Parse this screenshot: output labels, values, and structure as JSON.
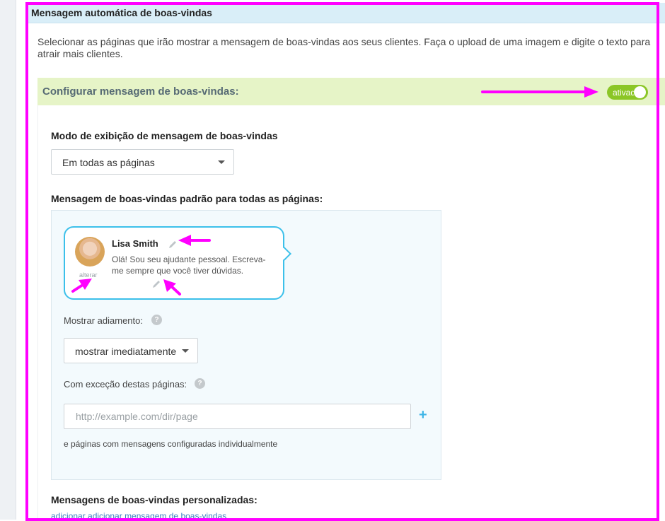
{
  "panel": {
    "title": "Mensagem automática de boas-vindas",
    "description": "Selecionar as páginas que irão mostrar a mensagem de boas-vindas aos seus clientes. Faça o upload de uma imagem e digite o texto para atrair mais clientes."
  },
  "config": {
    "title": "Configurar mensagem de boas-vindas:",
    "toggle_label": "ativado",
    "toggle_on": true
  },
  "display_mode": {
    "label": "Modo de exibição de mensagem de boas-vindas",
    "value": "Em todas as páginas"
  },
  "default_message": {
    "label": "Mensagem de boas-vindas padrão para todas as páginas:",
    "agent_name": "Lisa Smith",
    "avatar_change": "alterar",
    "greeting": "Olá! Sou seu ajudante pessoal. Escreva-me sempre que você tiver dúvidas.",
    "delay_label": "Mostrar adiamento:",
    "delay_value": "mostrar imediatamente",
    "exceptions_label": "Com exceção destas páginas:",
    "url_placeholder": "http://example.com/dir/page",
    "note": "e páginas com mensagens configuradas individualmente"
  },
  "custom_messages": {
    "label": "Mensagens de boas-vindas personalizadas:",
    "add_link": "adicionar adicionar mensagem de boas-vindas"
  },
  "icons": {
    "help": "help-icon",
    "edit": "pencil-icon",
    "add": "plus-icon"
  },
  "colors": {
    "header_bg": "#d9eef8",
    "config_bar_bg": "#e6f4c7",
    "toggle_on": "#8bc626",
    "bubble_border": "#3cc0ea",
    "annotation": "#ff00ff"
  }
}
